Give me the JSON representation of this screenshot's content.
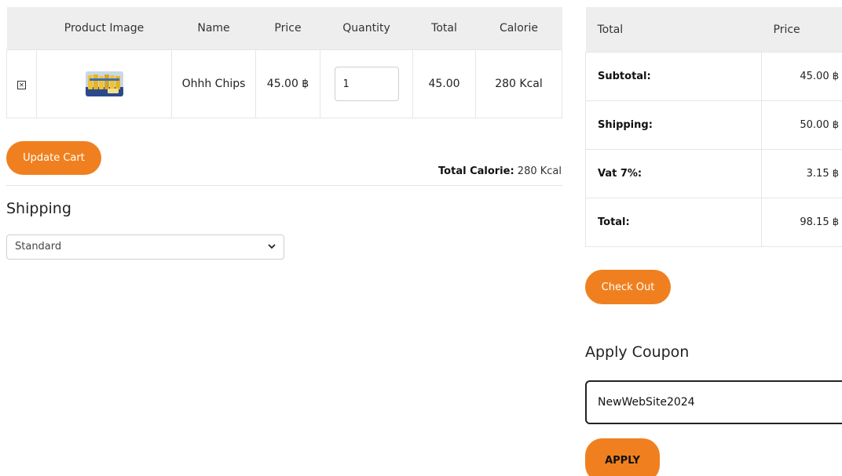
{
  "cart": {
    "headers": [
      "",
      "Product Image",
      "Name",
      "Price",
      "Quantity",
      "Total",
      "Calorie"
    ],
    "rows": [
      {
        "remove_icon": "✕",
        "product_image": "chips-product-image",
        "name": "Ohhh Chips",
        "price": "45.00 ฿",
        "quantity": "1",
        "total": "45.00",
        "calorie": "280 Kcal"
      }
    ]
  },
  "update_cart_label": "Update Cart",
  "total_calorie": {
    "label": "Total Calorie:",
    "value": "280 Kcal"
  },
  "shipping": {
    "title": "Shipping",
    "selected": "Standard"
  },
  "summary": {
    "headers": [
      "Total",
      "Price"
    ],
    "rows": [
      {
        "label": "Subtotal:",
        "value": "45.00 ฿"
      },
      {
        "label": "Shipping:",
        "value": "50.00 ฿"
      },
      {
        "label": "Vat 7%:",
        "value": "3.15 ฿"
      },
      {
        "label": "Total:",
        "value": "98.15 ฿"
      }
    ]
  },
  "checkout_label": "Check Out",
  "coupon": {
    "title": "Apply Coupon",
    "value": "NewWebSite2024",
    "apply_label": "APPLY"
  },
  "colors": {
    "accent": "#f0801f",
    "header_bg": "#eeeeee"
  }
}
